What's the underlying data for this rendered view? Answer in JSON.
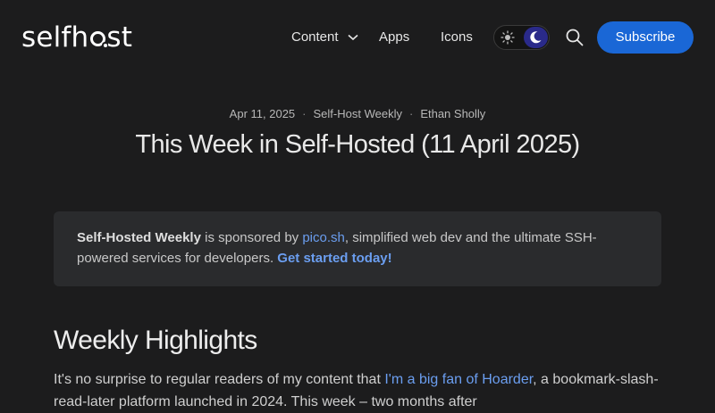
{
  "header": {
    "logo_left": "selfh",
    "logo_right": "st",
    "nav": {
      "content": "Content",
      "apps": "Apps",
      "icons": "Icons"
    },
    "subscribe": "Subscribe"
  },
  "article": {
    "date": "Apr 11, 2025",
    "category": "Self-Host Weekly",
    "author": "Ethan Sholly",
    "title": "This Week in Self-Hosted (11 April 2025)"
  },
  "sponsor": {
    "brand": "Self-Hosted Weekly",
    "text1": " is sponsored by ",
    "sponsor_link": "pico.sh",
    "text2": ", simplified web dev and the ultimate SSH-powered services for developers. ",
    "cta": "Get started today!"
  },
  "highlights": {
    "heading": "Weekly Highlights",
    "text1": "It's no surprise to regular readers of my content that ",
    "link": "I'm a big fan of Hoarder",
    "text2": ", a bookmark-slash-read-later platform launched in 2024. This week – two months after"
  },
  "colors": {
    "background": "#1c1c1d",
    "accent": "#1a67d6",
    "link": "#6b9ef0"
  }
}
